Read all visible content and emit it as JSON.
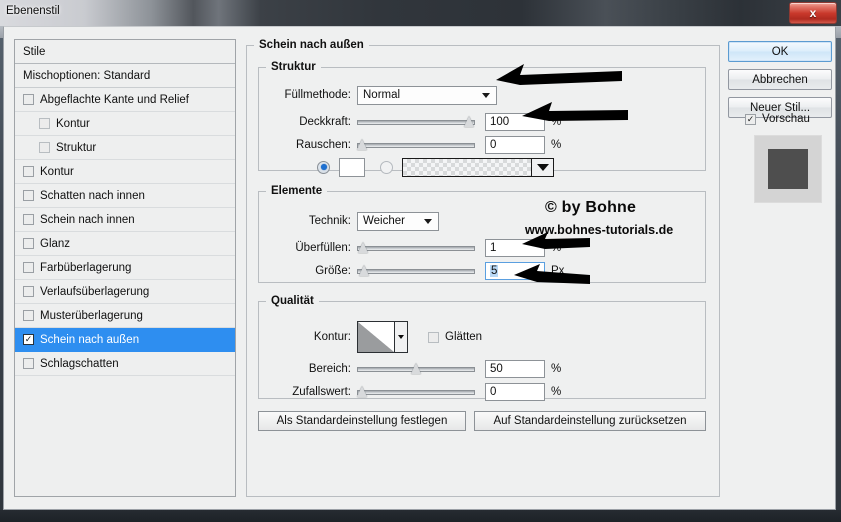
{
  "window": {
    "title": "Ebenenstil",
    "close_label": "x"
  },
  "sidebar": {
    "header": "Stile",
    "subheader": "Mischoptionen: Standard",
    "items": [
      {
        "label": "Abgeflachte Kante und Relief",
        "checked": false,
        "indent": false,
        "selected": false
      },
      {
        "label": "Kontur",
        "checked": false,
        "indent": true,
        "selected": false
      },
      {
        "label": "Struktur",
        "checked": false,
        "indent": true,
        "selected": false
      },
      {
        "label": "Kontur",
        "checked": false,
        "indent": false,
        "selected": false
      },
      {
        "label": "Schatten nach innen",
        "checked": false,
        "indent": false,
        "selected": false
      },
      {
        "label": "Schein nach innen",
        "checked": false,
        "indent": false,
        "selected": false
      },
      {
        "label": "Glanz",
        "checked": false,
        "indent": false,
        "selected": false
      },
      {
        "label": "Farbüberlagerung",
        "checked": false,
        "indent": false,
        "selected": false
      },
      {
        "label": "Verlaufsüberlagerung",
        "checked": false,
        "indent": false,
        "selected": false
      },
      {
        "label": "Musterüberlagerung",
        "checked": false,
        "indent": false,
        "selected": false
      },
      {
        "label": "Schein nach außen",
        "checked": true,
        "indent": false,
        "selected": true
      },
      {
        "label": "Schlagschatten",
        "checked": false,
        "indent": false,
        "selected": false
      }
    ],
    "check_glyph": "✓"
  },
  "main": {
    "panel_title": "Schein nach außen",
    "struktur": {
      "legend": "Struktur",
      "fuellmethode_label": "Füllmethode:",
      "fuellmethode_value": "Normal",
      "deckkraft_label": "Deckkraft:",
      "deckkraft_value": "100",
      "deckkraft_unit": "%",
      "deckkraft_percent": 100,
      "rauschen_label": "Rauschen:",
      "rauschen_value": "0",
      "rauschen_unit": "%",
      "rauschen_percent": 0,
      "color_mode_selected": "color",
      "color_swatch": "#ffffff"
    },
    "elemente": {
      "legend": "Elemente",
      "technik_label": "Technik:",
      "technik_value": "Weicher",
      "ueberfuellen_label": "Überfüllen:",
      "ueberfuellen_value": "1",
      "ueberfuellen_unit": "%",
      "ueberfuellen_percent": 1,
      "groesse_label": "Größe:",
      "groesse_value": "5",
      "groesse_unit": "Px",
      "groesse_percent": 2
    },
    "qualitaet": {
      "legend": "Qualität",
      "kontur_label": "Kontur:",
      "glaetten_label": "Glätten",
      "glaetten_checked": false,
      "bereich_label": "Bereich:",
      "bereich_value": "50",
      "bereich_unit": "%",
      "bereich_percent": 50,
      "zufallswert_label": "Zufallswert:",
      "zufallswert_value": "0",
      "zufallswert_unit": "%",
      "zufallswert_percent": 0
    },
    "default_buttons": {
      "set_default": "Als Standardeinstellung festlegen",
      "reset_default": "Auf Standardeinstellung zurücksetzen"
    }
  },
  "right": {
    "ok_label": "OK",
    "cancel_label": "Abbrechen",
    "new_style_label": "Neuer Stil...",
    "preview_label": "Vorschau",
    "preview_checked": true,
    "preview_check_glyph": "✓",
    "preview_swatch_color": "#4e4e4e",
    "preview_bg_color": "#d4d4d4"
  },
  "watermark": {
    "line1": "© by Bohne",
    "line2": "www.bohnes-tutorials.de"
  },
  "annotations": {
    "count": 4,
    "color": "#000000",
    "targets": [
      "fuellmethode-combo",
      "deckkraft-input",
      "ueberfuellen-input",
      "groesse-input"
    ]
  },
  "colors": {
    "accent_selection": "#2e8ef0",
    "dialog_bg": "#eff0f0",
    "close_button": "#c9382b"
  }
}
